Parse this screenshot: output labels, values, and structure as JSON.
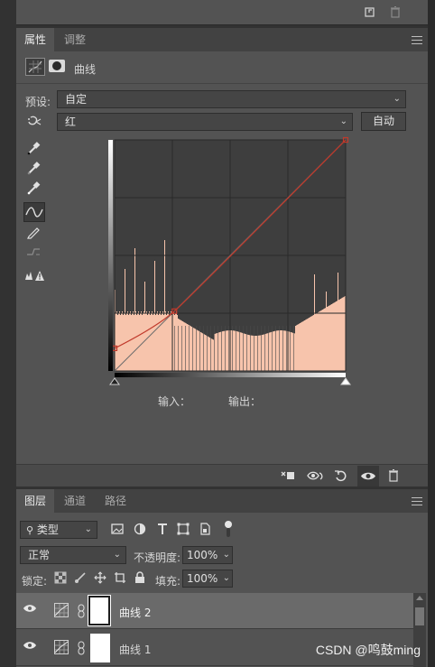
{
  "top_strip": {
    "icons": [
      "new-layer-icon",
      "trash-icon"
    ]
  },
  "properties_panel": {
    "tabs": [
      {
        "label": "属性",
        "active": true
      },
      {
        "label": "调整",
        "active": false
      }
    ],
    "header_title": "曲线",
    "preset_label": "预设:",
    "preset_value": "自定",
    "channel_value": "红",
    "auto_button": "自动",
    "input_label": "输入：",
    "output_label": "输出：",
    "curve": {
      "channel_color": "#c0392b",
      "points": [
        [
          0,
          25
        ],
        [
          66,
          66
        ],
        [
          255,
          255
        ]
      ]
    },
    "footer_icons": [
      "clip-to-layer-icon",
      "view-previous-icon",
      "reset-icon",
      "visibility-icon",
      "trash-icon"
    ]
  },
  "layers_panel": {
    "tabs": [
      {
        "label": "图层",
        "active": true
      },
      {
        "label": "通道",
        "active": false
      },
      {
        "label": "路径",
        "active": false
      }
    ],
    "filter_kind": "类型",
    "blend_mode": "正常",
    "opacity_label": "不透明度:",
    "opacity_value": "100%",
    "lock_label": "锁定:",
    "fill_label": "填充:",
    "fill_value": "100%",
    "layers": [
      {
        "name": "曲线 2",
        "selected": true
      },
      {
        "name": "曲线 1",
        "selected": false
      }
    ]
  },
  "watermark": "CSDN @鸣鼓ming",
  "colors": {
    "panel": "#535353",
    "histogram": "#f7c4ac",
    "curve": "#c0392b"
  }
}
